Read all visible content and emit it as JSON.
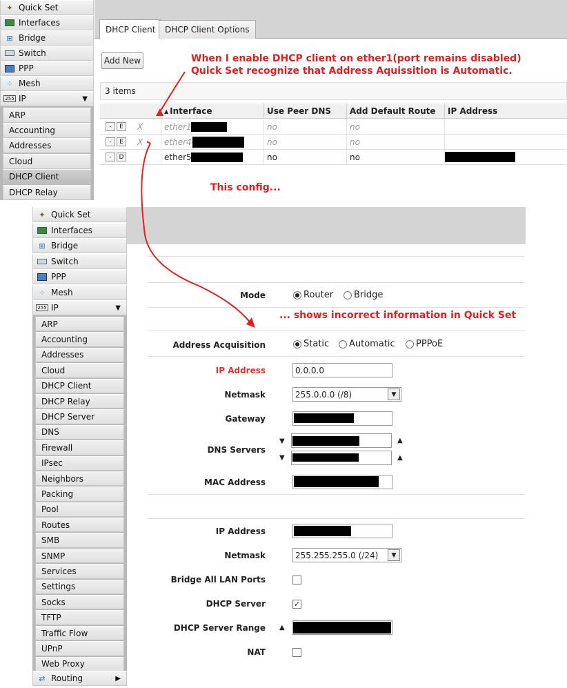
{
  "top": {
    "menu": [
      "Quick Set",
      "Interfaces",
      "Bridge",
      "Switch",
      "PPP",
      "Mesh",
      "IP"
    ],
    "ip_submenu": [
      "ARP",
      "Accounting",
      "Addresses",
      "Cloud",
      "DHCP Client",
      "DHCP Relay"
    ],
    "tabs": [
      "DHCP Client",
      "DHCP Client Options"
    ],
    "add_new": "Add New",
    "items_count": "3 items",
    "columns": [
      "Interface",
      "Use Peer DNS",
      "Add Default Route",
      "IP Address"
    ],
    "rows": [
      {
        "flag": "X",
        "btn": "E",
        "interface": "ether1-",
        "peer_dns": "no",
        "default_route": "no",
        "disabled": true
      },
      {
        "flag": "X",
        "btn": "E",
        "interface": "ether4-",
        "peer_dns": "no",
        "default_route": "no",
        "disabled": true
      },
      {
        "flag": "",
        "btn": "D",
        "interface": "ether5-",
        "peer_dns": "no",
        "default_route": "no",
        "disabled": false
      }
    ],
    "minus": "-"
  },
  "annotations": {
    "line1": "When I enable DHCP client on ether1(port remains disabled)",
    "line2": "Quick Set recognize that Address Aquissition is Automatic.",
    "this_config": "This config...",
    "shows": "... shows incorrect information in Quick Set"
  },
  "bottom": {
    "menu": [
      "Quick Set",
      "Interfaces",
      "Bridge",
      "Switch",
      "PPP",
      "Mesh",
      "IP"
    ],
    "ip_submenu": [
      "ARP",
      "Accounting",
      "Addresses",
      "Cloud",
      "DHCP Client",
      "DHCP Relay",
      "DHCP Server",
      "DNS",
      "Firewall",
      "IPsec",
      "Neighbors",
      "Packing",
      "Pool",
      "Routes",
      "SMB",
      "SNMP",
      "Services",
      "Settings",
      "Socks",
      "TFTP",
      "Traffic Flow",
      "UPnP",
      "Web Proxy"
    ],
    "routing": "Routing"
  },
  "form": {
    "mode_label": "Mode",
    "mode_options": [
      "Router",
      "Bridge"
    ],
    "mode_selected": "Router",
    "acq_label": "Address Acquisition",
    "acq_options": [
      "Static",
      "Automatic",
      "PPPoE"
    ],
    "acq_selected": "Static",
    "ip_label": "IP Address",
    "ip_value": "0.0.0.0",
    "netmask_label": "Netmask",
    "netmask_value": "255.0.0.0 (/8)",
    "gateway_label": "Gateway",
    "dns_label": "DNS Servers",
    "mac_label": "MAC Address",
    "lan_ip_label": "IP Address",
    "lan_netmask_label": "Netmask",
    "lan_netmask_value": "255.255.255.0 (/24)",
    "bridge_lan_label": "Bridge All LAN Ports",
    "bridge_lan_checked": false,
    "dhcp_server_label": "DHCP Server",
    "dhcp_server_checked": true,
    "dhcp_range_label": "DHCP Server Range",
    "nat_label": "NAT",
    "nat_checked": false
  },
  "colors": {
    "annotation": "#e02020",
    "ip_label": "#e03030"
  }
}
